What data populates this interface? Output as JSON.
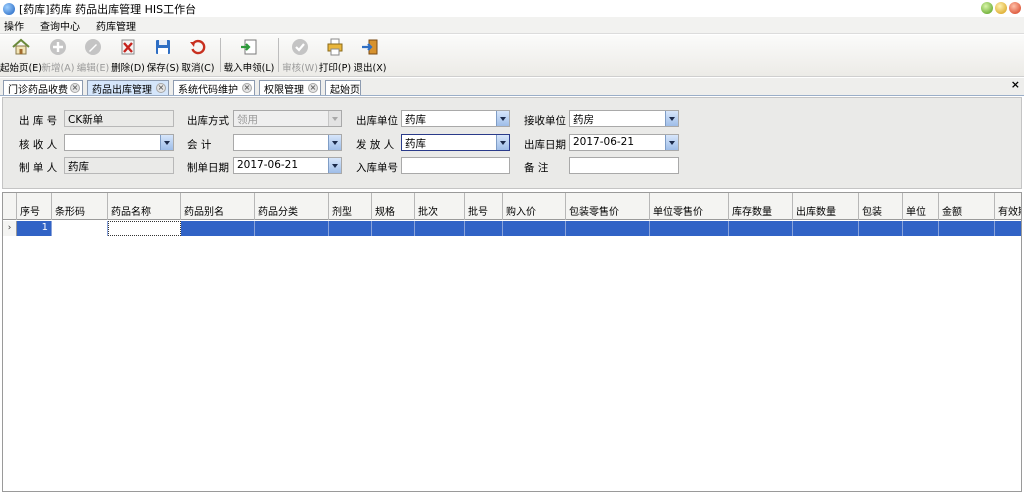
{
  "window": {
    "title": "[药库]药库 药品出库管理  HIS工作台"
  },
  "menu": [
    "操作",
    "查询中心",
    "药库管理"
  ],
  "toolbar": [
    {
      "label": "起始页(E)",
      "icon": "home-icon",
      "enabled": true
    },
    {
      "label": "新增(A)",
      "icon": "add-icon",
      "enabled": false
    },
    {
      "label": "编辑(E)",
      "icon": "edit-icon",
      "enabled": false
    },
    {
      "label": "删除(D)",
      "icon": "delete-icon",
      "enabled": true
    },
    {
      "label": "保存(S)",
      "icon": "save-icon",
      "enabled": true
    },
    {
      "label": "取消(C)",
      "icon": "undo-icon",
      "enabled": true
    },
    {
      "label": "载入申领(L)",
      "icon": "import-icon",
      "enabled": true
    },
    {
      "label": "审核(W)",
      "icon": "approve-icon",
      "enabled": false
    },
    {
      "label": "打印(P)",
      "icon": "print-icon",
      "enabled": true
    },
    {
      "label": "退出(X)",
      "icon": "exit-icon",
      "enabled": true
    }
  ],
  "tabs": [
    {
      "label": "门诊药品收费",
      "active": false
    },
    {
      "label": "药品出库管理",
      "active": true
    },
    {
      "label": "系统代码维护",
      "active": false
    },
    {
      "label": "权限管理",
      "active": false
    },
    {
      "label": "起始页",
      "active": false
    }
  ],
  "form": {
    "ck_no_label": "出 库 号",
    "ck_no_value": "CK新单",
    "ck_method_label": "出库方式",
    "ck_method_value": "领用",
    "ck_unit_label": "出库单位",
    "ck_unit_value": "药库",
    "recv_unit_label": "接收单位",
    "recv_unit_value": "药房",
    "checker_label": "核 收 人",
    "checker_value": "",
    "accountant_label": "会    计",
    "accountant_value": "",
    "sender_label": "发 放 人",
    "sender_value": "药库",
    "ck_date_label": "出库日期",
    "ck_date_value": "2017-06-21",
    "maker_label": "制 单 人",
    "maker_value": "药库",
    "make_date_label": "制单日期",
    "make_date_value": "2017-06-21",
    "rk_no_label": "入库单号",
    "rk_no_value": "",
    "remark_label": "备    注",
    "remark_value": ""
  },
  "grid": {
    "columns": [
      "序号",
      "条形码",
      "药品名称",
      "药品别名",
      "药品分类",
      "剂型",
      "规格",
      "批次",
      "批号",
      "购入价",
      "包装零售价",
      "单位零售价",
      "库存数量",
      "出库数量",
      "包装",
      "单位",
      "金额",
      "有效期"
    ],
    "rows": [
      {
        "seq": "1",
        "barcode": "",
        "name": "",
        "alias": "",
        "category": "",
        "form": "",
        "spec": "",
        "batch": "",
        "lot": "",
        "cost": "",
        "pkg_price": "",
        "unit_price": "",
        "stock": "",
        "qty": "",
        "pkg": "",
        "unit": "",
        "amount": "",
        "expiry": ""
      }
    ]
  },
  "colors": {
    "selected_row": "#3163c6",
    "active_tab": "#d5e6fb"
  }
}
